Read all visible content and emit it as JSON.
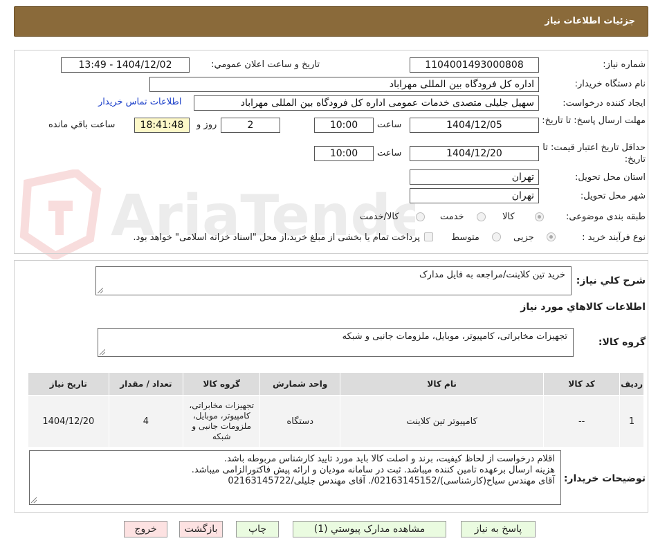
{
  "header": {
    "title": "جزئیات اطلاعات نیاز"
  },
  "form": {
    "need_number": {
      "label": "شماره نیاز:",
      "value": "1104001493000808"
    },
    "announce_datetime": {
      "label": "تاریخ و ساعت اعلان عمومي:",
      "value": "1404/12/02 - 13:49"
    },
    "buyer_org": {
      "label": "نام دستگاه خريدار:",
      "value": "اداره کل فرودگاه بین المللی مهراباد"
    },
    "requester": {
      "label": "ايجاد کننده درخواست:",
      "value": "سهیل جلیلی متصدی خدمات عمومی اداره کل فرودگاه بین المللی مهراباد"
    },
    "contact_link": "اطلاعات تماس خريدار",
    "reply_deadline": {
      "label": "مهلت ارسال پاسخ: تا تاریخ:",
      "date": "1404/12/05",
      "time_label": "ساعت",
      "time": "10:00",
      "days": "2",
      "days_label": "روز و",
      "remaining": "18:41:48",
      "remaining_label": "ساعت باقي مانده"
    },
    "price_validity": {
      "label": "حداقل تاريخ اعتبار قيمت: تا تاريخ:",
      "date": "1404/12/20",
      "time_label": "ساعت",
      "time": "10:00"
    },
    "delivery_province": {
      "label": "استان محل تحويل:",
      "value": "تهران"
    },
    "delivery_city": {
      "label": "شهر محل تحويل:",
      "value": "تهران"
    },
    "category": {
      "label": "طبقه بندی موضوعی:",
      "options": [
        "کالا",
        "خدمت",
        "کالا/خدمت"
      ],
      "selected": "کالا"
    },
    "purchase_process": {
      "label": "نوع فرآیند خرید :",
      "options": [
        "جزیی",
        "متوسط"
      ],
      "selected": "جزیی",
      "treasury_note": "پرداخت تمام يا بخشی از مبلغ خريد،از محل \"اسناد خزانه اسلامی\" خواهد بود."
    }
  },
  "summary": {
    "label": "شرح کلي نياز:",
    "value": "خرید تین کلاینت/مراجعه به فایل مدارک"
  },
  "goods_section": {
    "heading": "اطلاعات کالاهاي مورد نياز",
    "group_label": "گروه کالا:",
    "group_value": "تجهیزات مخابراتی، کامپیوتر، موبایل، ملزومات جانبی و شبکه",
    "table": {
      "headers": [
        "رديف",
        "کد کالا",
        "نام کالا",
        "واحد شمارش",
        "گروه کالا",
        "تعداد / مقدار",
        "تاریخ نیاز"
      ],
      "rows": [
        [
          "1",
          "--",
          "کامپیوتر تین کلاینت",
          "دستگاه",
          "تجهیزات مخابراتی، کامپیوتر، موبایل، ملزومات جانبی و شبکه",
          "4",
          "1404/12/20"
        ]
      ]
    }
  },
  "buyer_notes": {
    "label": "توضیحات خریدار:",
    "lines": [
      "اقلام درخواست از لحاظ کیفیت، برند و اصلت کالا باید مورد تایید کارشناس مربوطه باشد.",
      "هزینه ارسال برعهده تامین کننده میباشد. ثبت در سامانه مودیان و ارائه پیش فاکتورالزامی میباشد.",
      "آقای مهندس سیاح(کارشناسی)/02163145152/. آقای مهندس جلیلی/02163145722"
    ]
  },
  "buttons": {
    "reply": "پاسخ به نياز",
    "attachments": "مشاهده مدارک پيوستي (1)",
    "print": "چاپ",
    "back": "بازگشت",
    "exit": "خروج"
  },
  "watermark": "AriaTender.neT",
  "colors": {
    "header_bg": "#8a6a3a",
    "link": "#1a3ec9",
    "button_green": "#eafbe0",
    "button_red": "#fde2e2"
  }
}
